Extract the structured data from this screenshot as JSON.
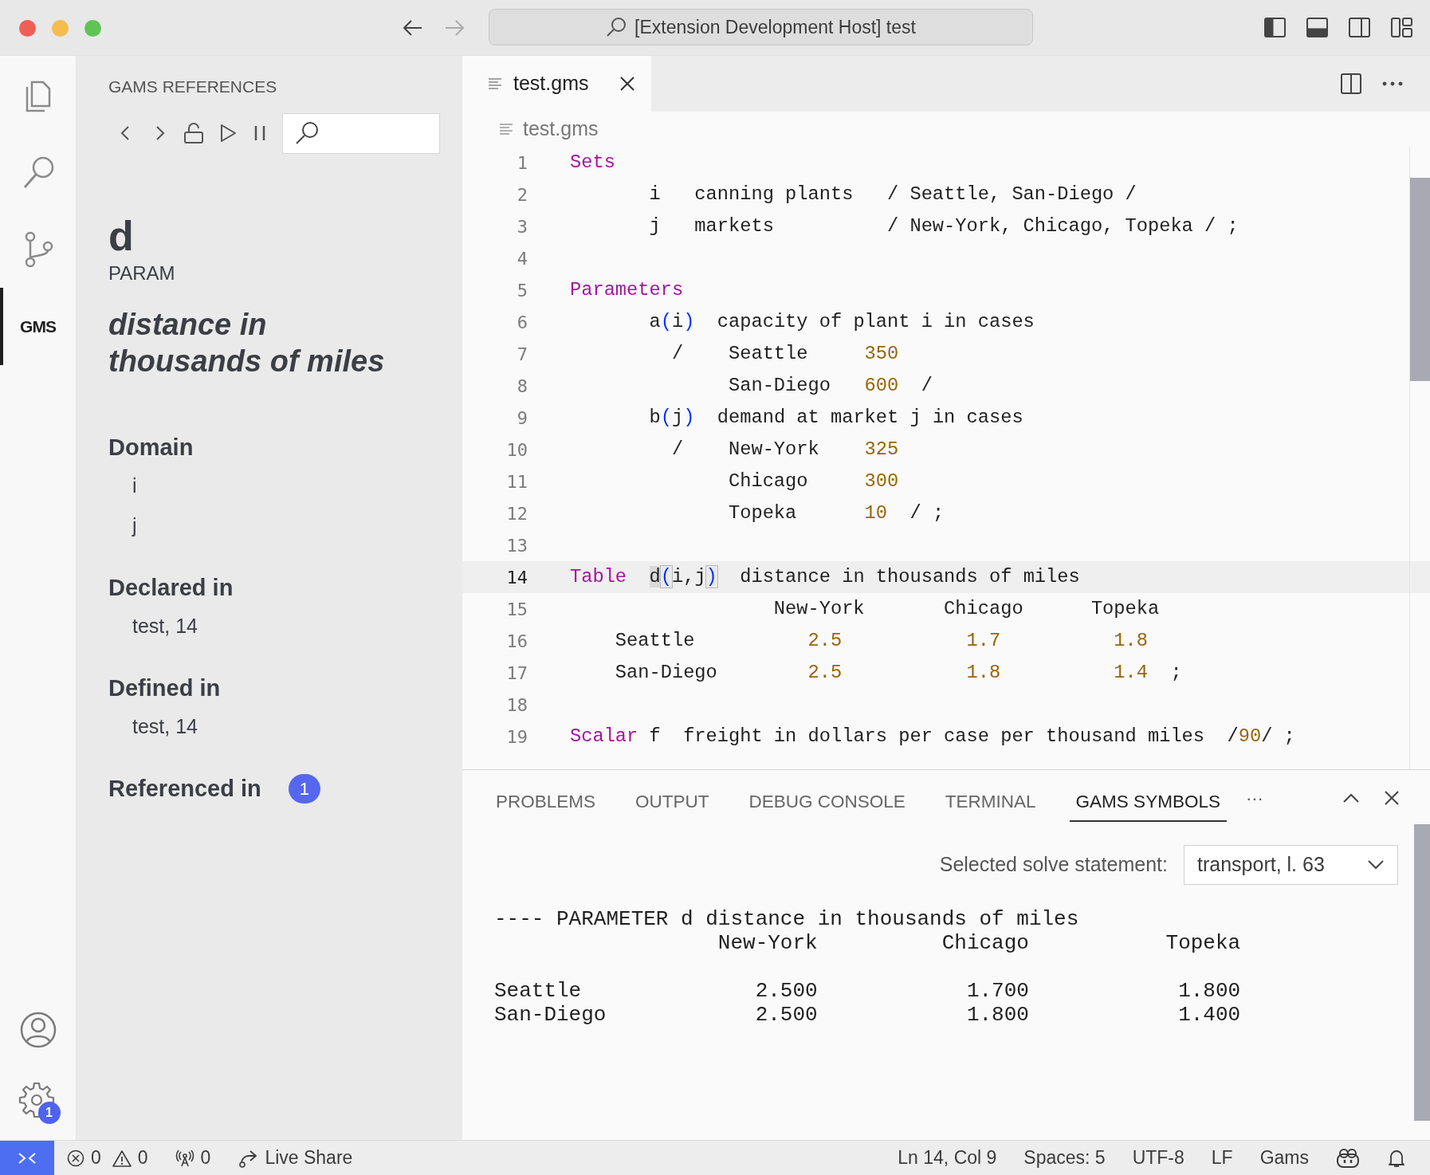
{
  "window": {
    "title": "[Extension Development Host] test"
  },
  "activity_bar": {
    "items": [
      {
        "kind": "files",
        "selected": false
      },
      {
        "kind": "search",
        "selected": false
      },
      {
        "kind": "source-control",
        "selected": false
      },
      {
        "kind": "gams",
        "label": "GMS",
        "selected": true
      }
    ],
    "bottom": [
      {
        "kind": "account"
      },
      {
        "kind": "settings",
        "badge": "1"
      }
    ]
  },
  "sidebar": {
    "title": "GAMS REFERENCES",
    "symbol": "d",
    "symbol_type": "PARAM",
    "description": "distance in thousands of miles",
    "sections": [
      {
        "heading": "Domain",
        "entries": [
          "i",
          "j"
        ]
      },
      {
        "heading": "Declared in",
        "entries": [
          "test, 14"
        ]
      },
      {
        "heading": "Defined in",
        "entries": [
          "test, 14"
        ]
      },
      {
        "heading": "Referenced in",
        "badge": "1"
      }
    ]
  },
  "editor": {
    "tabs": [
      {
        "label": "test.gms",
        "selected": true
      }
    ],
    "breadcrumb": "test.gms",
    "lines": [
      {
        "number": "1",
        "current": false,
        "tokens": [
          {
            "kind": "keyword",
            "text": "Sets"
          }
        ]
      },
      {
        "number": "2",
        "current": false,
        "tokens": [
          {
            "kind": "plain",
            "text": "       i   canning plants   / Seattle, San-Diego /"
          }
        ]
      },
      {
        "number": "3",
        "current": false,
        "tokens": [
          {
            "kind": "plain",
            "text": "       j   markets          / New-York, Chicago, Topeka / ;"
          }
        ]
      },
      {
        "number": "4",
        "current": false
      },
      {
        "number": "5",
        "current": false,
        "tokens": [
          {
            "kind": "keyword",
            "text": "Parameters"
          }
        ]
      },
      {
        "number": "6",
        "current": false,
        "tokens": [
          {
            "kind": "plain",
            "text": "       a"
          },
          {
            "kind": "paren",
            "text": "("
          },
          {
            "kind": "plain",
            "text": "i"
          },
          {
            "kind": "paren",
            "text": ")"
          },
          {
            "kind": "plain",
            "text": "  capacity of plant i in cases"
          }
        ]
      },
      {
        "number": "7",
        "current": false,
        "tokens": [
          {
            "kind": "plain",
            "text": "         /    Seattle     "
          },
          {
            "kind": "number",
            "text": "350"
          }
        ]
      },
      {
        "number": "8",
        "current": false,
        "tokens": [
          {
            "kind": "plain",
            "text": "              San-Diego   "
          },
          {
            "kind": "number",
            "text": "600"
          },
          {
            "kind": "plain",
            "text": "  /"
          }
        ]
      },
      {
        "number": "9",
        "current": false,
        "tokens": [
          {
            "kind": "plain",
            "text": "       b"
          },
          {
            "kind": "paren",
            "text": "("
          },
          {
            "kind": "plain",
            "text": "j"
          },
          {
            "kind": "paren",
            "text": ")"
          },
          {
            "kind": "plain",
            "text": "  demand at market j in cases"
          }
        ]
      },
      {
        "number": "10",
        "current": false,
        "tokens": [
          {
            "kind": "plain",
            "text": "         /    New-York    "
          },
          {
            "kind": "number",
            "text": "325"
          }
        ]
      },
      {
        "number": "11",
        "current": false,
        "tokens": [
          {
            "kind": "plain",
            "text": "              Chicago     "
          },
          {
            "kind": "number",
            "text": "300"
          }
        ]
      },
      {
        "number": "12",
        "current": false,
        "tokens": [
          {
            "kind": "plain",
            "text": "              Topeka      "
          },
          {
            "kind": "number",
            "text": "10"
          },
          {
            "kind": "plain",
            "text": "  / ;"
          }
        ]
      },
      {
        "number": "13",
        "current": false
      },
      {
        "number": "14",
        "current": true,
        "tokens": [
          {
            "kind": "keyword",
            "text": "Table  "
          },
          {
            "kind": "highlight",
            "text": "d"
          },
          {
            "kind": "bracket",
            "text": "("
          },
          {
            "kind": "plain",
            "text": "i,j"
          },
          {
            "kind": "bracket",
            "text": ")"
          },
          {
            "kind": "plain",
            "text": "  distance in thousands of miles"
          }
        ]
      },
      {
        "number": "15",
        "current": false,
        "tokens": [
          {
            "kind": "plain",
            "text": "                  New-York       Chicago      Topeka"
          }
        ]
      },
      {
        "number": "16",
        "current": false,
        "tokens": [
          {
            "kind": "plain",
            "text": "    Seattle          "
          },
          {
            "kind": "number",
            "text": "2.5           1.7          1.8"
          }
        ]
      },
      {
        "number": "17",
        "current": false,
        "tokens": [
          {
            "kind": "plain",
            "text": "    San-Diego        "
          },
          {
            "kind": "number",
            "text": "2.5           1.8          1.4"
          },
          {
            "kind": "plain",
            "text": "  ;"
          }
        ]
      },
      {
        "number": "18",
        "current": false
      },
      {
        "number": "19",
        "current": false,
        "tokens": [
          {
            "kind": "keyword",
            "text": "Scalar"
          },
          {
            "kind": "plain",
            "text": " f  freight in dollars per case per thousand miles  /"
          },
          {
            "kind": "number",
            "text": "90"
          },
          {
            "kind": "plain",
            "text": "/ ;"
          }
        ]
      }
    ]
  },
  "panel": {
    "tabs": [
      {
        "label": "PROBLEMS",
        "selected": false
      },
      {
        "label": "OUTPUT",
        "selected": false
      },
      {
        "label": "DEBUG CONSOLE",
        "selected": false
      },
      {
        "label": "TERMINAL",
        "selected": false
      },
      {
        "label": "GAMS SYMBOLS",
        "selected": true
      }
    ],
    "more": "···",
    "solve_label": "Selected solve statement:",
    "solve_value": "transport, l. 63",
    "output": {
      "header": "---- PARAMETER d distance in thousands of miles",
      "columns": "                  New-York          Chicago           Topeka",
      "rows": [
        "Seattle              2.500            1.700            1.800",
        "San-Diego            2.500            1.800            1.400"
      ]
    }
  },
  "status_bar": {
    "left": [
      {
        "kind": "errors",
        "text": "0"
      },
      {
        "kind": "warnings",
        "text": "0"
      },
      {
        "kind": "ports",
        "text": "0"
      },
      {
        "kind": "live-share",
        "text": "Live Share"
      }
    ],
    "right": [
      {
        "kind": "text",
        "text": "Ln 14, Col 9"
      },
      {
        "kind": "text",
        "text": "Spaces: 5"
      },
      {
        "kind": "text",
        "text": "UTF-8"
      },
      {
        "kind": "text",
        "text": "LF"
      },
      {
        "kind": "text",
        "text": "Gams"
      },
      {
        "kind": "copilot"
      },
      {
        "kind": "bell"
      }
    ]
  }
}
